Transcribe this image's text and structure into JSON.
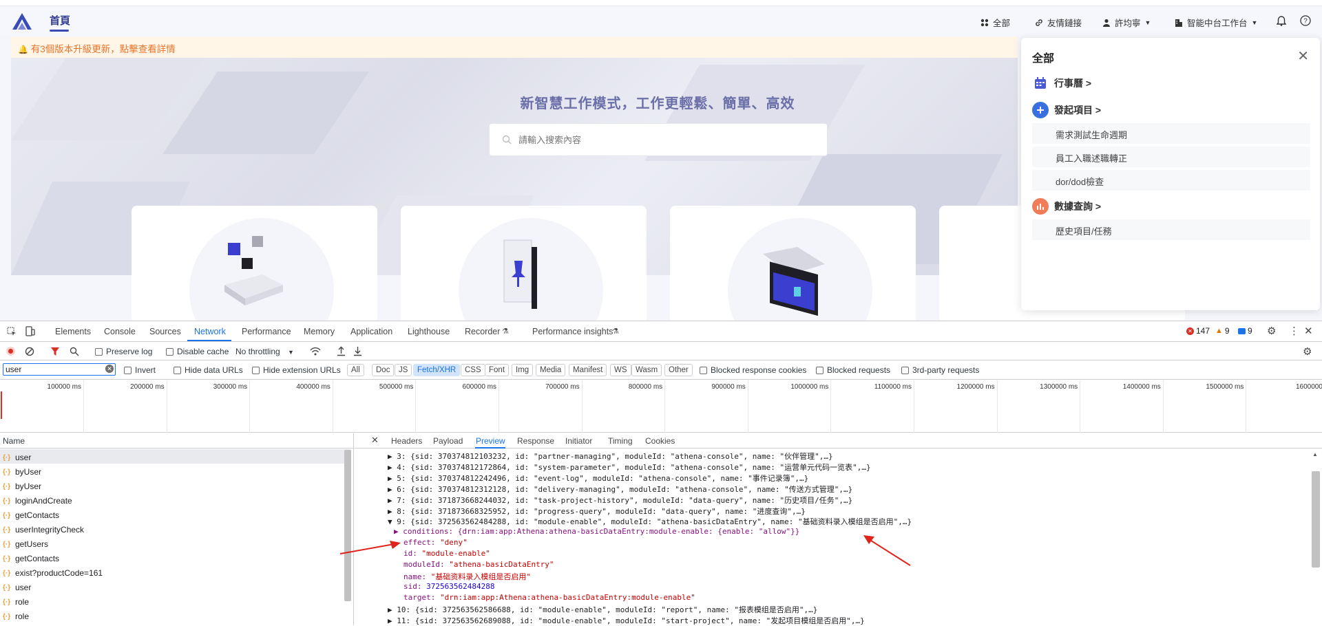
{
  "app": {
    "home_tab": "首頁",
    "nav": {
      "all": "全部",
      "friend_links": "友情鏈接",
      "user": "許均寧",
      "workspace": "智能中台工作台"
    },
    "notice": "有3個版本升級更新，點擊查看詳情",
    "hero_title": "新智慧工作模式，工作更輕鬆、簡單、高效",
    "search_placeholder": "請輸入搜索內容",
    "colors": {
      "accent": "#3a4bb8",
      "notice_text": "#e8742a",
      "notice_bg": "#fff6e8"
    }
  },
  "panel": {
    "title": "全部",
    "close": "✕",
    "sections": [
      {
        "label": "行事曆 >",
        "icon": "calendar-icon",
        "color": "#4b5bd6"
      },
      {
        "label": "發起項目 >",
        "icon": "plus-circle-icon",
        "color": "#3a6fe0"
      },
      {
        "label": "數據查詢 >",
        "icon": "chart-icon",
        "color": "#f07c5a"
      }
    ],
    "items": [
      "需求測試生命週期",
      "員工入職述職轉正",
      "dor/dod檢查",
      "歷史項目/任務"
    ]
  },
  "devtools": {
    "tabs": [
      "Elements",
      "Console",
      "Sources",
      "Network",
      "Performance",
      "Memory",
      "Application",
      "Lighthouse",
      "Recorder",
      "Performance insights"
    ],
    "active_tab": "Network",
    "counts": {
      "errors": "147",
      "warnings": "9",
      "info": "9"
    },
    "toolbar": {
      "preserve_log": "Preserve log",
      "disable_cache": "Disable cache",
      "throttling": "No throttling"
    },
    "filter": {
      "value": "user",
      "invert": "Invert",
      "hide_data_urls": "Hide data URLs",
      "hide_ext_urls": "Hide extension URLs",
      "types": [
        "All",
        "Doc",
        "JS",
        "Fetch/XHR",
        "CSS",
        "Font",
        "Img",
        "Media",
        "Manifest",
        "WS",
        "Wasm",
        "Other"
      ],
      "active_type": "Fetch/XHR",
      "blocked_cookies": "Blocked response cookies",
      "blocked_requests": "Blocked requests",
      "third_party": "3rd-party requests"
    },
    "timeline_ticks": [
      "100000 ms",
      "200000 ms",
      "300000 ms",
      "400000 ms",
      "500000 ms",
      "600000 ms",
      "700000 ms",
      "800000 ms",
      "900000 ms",
      "1000000 ms",
      "1100000 ms",
      "1200000 ms",
      "1300000 ms",
      "1400000 ms",
      "1500000 ms",
      "1600000 r"
    ],
    "name_header": "Name",
    "requests": [
      "user",
      "byUser",
      "byUser",
      "loginAndCreate",
      "getContacts",
      "userIntegrityCheck",
      "getUsers",
      "getContacts",
      "exist?productCode=161",
      "user",
      "role",
      "role"
    ],
    "detail_tabs": [
      "Headers",
      "Payload",
      "Preview",
      "Response",
      "Initiator",
      "Timing",
      "Cookies"
    ],
    "active_detail_tab": "Preview",
    "preview_lines": [
      "▶ 3: {sid: 370374812103232, id: \"partner-managing\", moduleId: \"athena-console\", name: \"伙伴管理\",…}",
      "▶ 4: {sid: 370374812172864, id: \"system-parameter\", moduleId: \"athena-console\", name: \"运营单元代码一览表\",…}",
      "▶ 5: {sid: 370374812242496, id: \"event-log\", moduleId: \"athena-console\", name: \"事件记录簿\",…}",
      "▶ 6: {sid: 370374812312128, id: \"delivery-managing\", moduleId: \"athena-console\", name: \"传送方式管理\",…}",
      "▶ 7: {sid: 371873668244032, id: \"task-project-history\", moduleId: \"data-query\", name: \"历史项目/任务\",…}",
      "▶ 8: {sid: 371873668325952, id: \"progress-query\", moduleId: \"data-query\", name: \"进度查询\",…}",
      "▼ 9: {sid: 372563562484288, id: \"module-enable\", moduleId: \"athena-basicDataEntry\", name: \"基础资料录入模组是否启用\",…}"
    ],
    "expanded": {
      "conditions": "▶ conditions: {drn:iam:app:Athena:athena-basicDataEntry:module-enable: {enable: \"allow\"}}",
      "effect_key": "effect: ",
      "effect_val": "\"deny\"",
      "id_key": "id: ",
      "id_val": "\"module-enable\"",
      "module_key": "moduleId: ",
      "module_val": "\"athena-basicDataEntry\"",
      "name_key": "name: ",
      "name_val": "\"基础资料录入模组是否启用\"",
      "sid_key": "sid: ",
      "sid_val": "372563562484288",
      "target_key": "target: ",
      "target_val": "\"drn:iam:app:Athena:athena-basicDataEntry:module-enable\""
    },
    "trailing_lines": [
      "▶ 10: {sid: 372563562586688, id: \"module-enable\", moduleId: \"report\", name: \"报表模组是否启用\",…}",
      "▶ 11: {sid: 372563562689088, id: \"module-enable\", moduleId: \"start-project\", name: \"发起项目模组是否启用\",…}"
    ]
  }
}
